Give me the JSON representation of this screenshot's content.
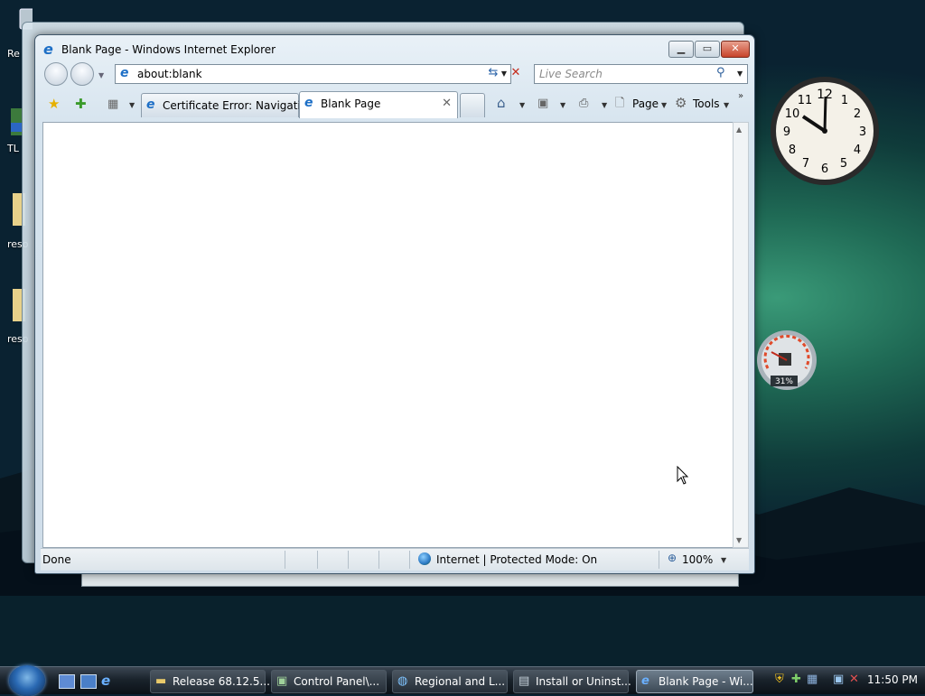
{
  "desktop": {
    "icons": [
      {
        "label": "Re"
      },
      {
        "label": "TL"
      },
      {
        "label": "reso"
      },
      {
        "label": "reso"
      }
    ]
  },
  "ie_window": {
    "title": "Blank Page - Windows Internet Explorer",
    "address": "about:blank",
    "search_placeholder": "Live Search",
    "tabs": [
      {
        "label": "Certificate Error: Navigati..."
      },
      {
        "label": "Blank Page",
        "active": true
      }
    ],
    "commands": {
      "page": "Page",
      "tools": "Tools"
    },
    "status": {
      "text": "Done",
      "zone": "Internet | Protected Mode: On",
      "zoom": "100%"
    }
  },
  "gadgets": {
    "clock": {
      "numbers": [
        "12",
        "1",
        "2",
        "3",
        "4",
        "5",
        "6",
        "7",
        "8",
        "9",
        "10",
        "11"
      ]
    },
    "cpu": {
      "value": "31%"
    }
  },
  "taskbar": {
    "tasks": [
      {
        "label": "Release 68.12.5...",
        "icon": "folder-icon"
      },
      {
        "label": "Control Panel\\...",
        "icon": "control-panel-icon"
      },
      {
        "label": "Regional and L...",
        "icon": "globe-icon"
      },
      {
        "label": "Install or Uninst...",
        "icon": "programs-icon"
      },
      {
        "label": "Blank Page - Wi...",
        "icon": "ie-icon",
        "active": true
      }
    ],
    "time": "11:50 PM"
  },
  "colors": {
    "accent": "#2a69b3",
    "close_button": "#c7442b",
    "taskbar": "#1a232c"
  }
}
